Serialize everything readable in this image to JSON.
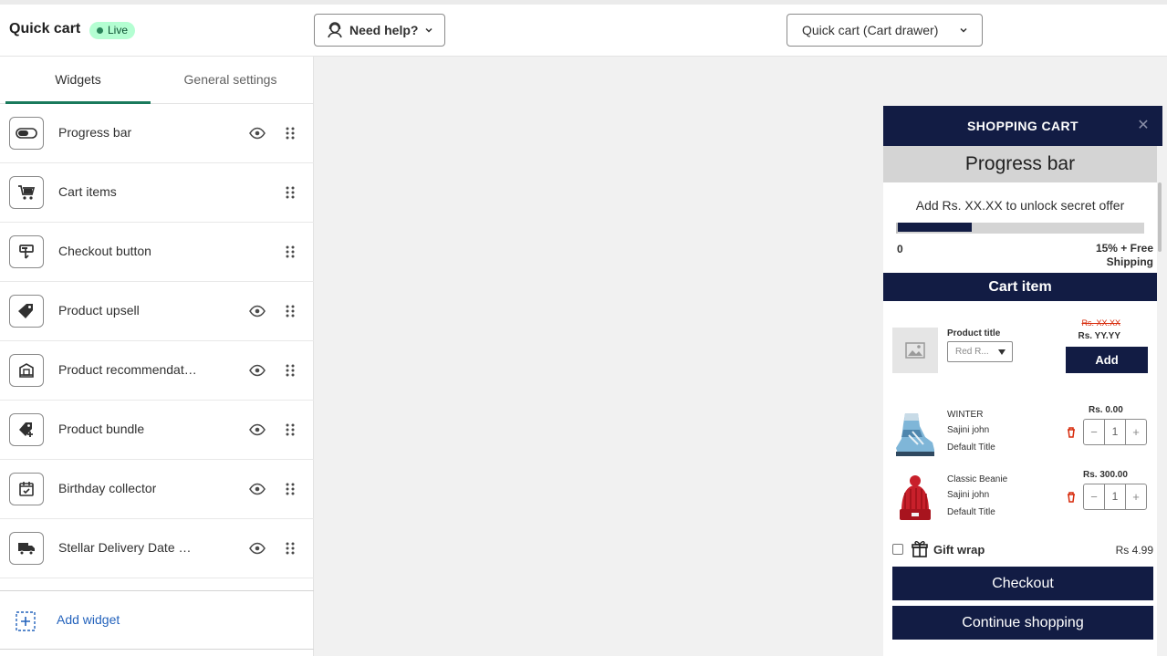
{
  "header": {
    "app_title": "Quick cart",
    "status_badge": "Live",
    "help_button": "Need help?",
    "template_select": "Quick cart (Cart drawer)"
  },
  "sidebar": {
    "tabs": [
      {
        "label": "Widgets",
        "active": true
      },
      {
        "label": "General settings",
        "active": false
      }
    ],
    "widgets": [
      {
        "label": "Progress bar",
        "icon": "toggle-icon",
        "visible_toggle": true
      },
      {
        "label": "Cart items",
        "icon": "cart-icon",
        "visible_toggle": false
      },
      {
        "label": "Checkout button",
        "icon": "checkout-icon",
        "visible_toggle": false
      },
      {
        "label": "Product upsell",
        "icon": "tag-icon",
        "visible_toggle": true
      },
      {
        "label": "Product recommendat…",
        "icon": "store-icon",
        "visible_toggle": true
      },
      {
        "label": "Product bundle",
        "icon": "tag-plus-icon",
        "visible_toggle": true
      },
      {
        "label": "Birthday collector",
        "icon": "calendar-check-icon",
        "visible_toggle": true
      },
      {
        "label": "Stellar Delivery Date & …",
        "icon": "truck-icon",
        "visible_toggle": true
      }
    ],
    "add_widget": "Add widget"
  },
  "cart": {
    "title": "SHOPPING CART",
    "close_symbol": "✕",
    "progress": {
      "section_title": "Progress bar",
      "message": "Add Rs. XX.XX to unlock secret offer",
      "start_label": "0",
      "end_label": "15% + Free Shipping",
      "fill_fraction": 0.3
    },
    "cart_item_title": "Cart item",
    "upsell": {
      "title": "Product title",
      "variant": "Red R...",
      "old_price": "Rs. XX.XX",
      "new_price": "Rs. YY.YY",
      "add_label": "Add"
    },
    "items": [
      {
        "name": "WINTER",
        "vendor": "Sajini john",
        "variant": "Default Title",
        "price": "Rs. 0.00",
        "qty": "1",
        "image": "boot"
      },
      {
        "name": "Classic Beanie",
        "vendor": "Sajini john",
        "variant": "Default Title",
        "price": "Rs. 300.00",
        "qty": "1",
        "image": "beanie"
      }
    ],
    "gift_wrap": {
      "label": "Gift wrap",
      "price": "Rs 4.99",
      "checked": false
    },
    "checkout_label": "Checkout",
    "continue_label": "Continue shopping"
  },
  "colors": {
    "cart_primary": "#121c44",
    "tab_accent": "#1a7a5c",
    "badge_bg": "#b4fed2",
    "link": "#2463bc",
    "danger": "#d72c0d"
  }
}
